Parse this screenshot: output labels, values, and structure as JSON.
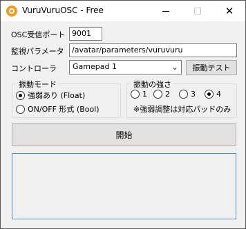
{
  "window": {
    "title": "VuruVuruOSC - Free",
    "close_glyph": "✕"
  },
  "form": {
    "osc_port_label": "OSC受信ポート",
    "osc_port_value": "9001",
    "param_label": "監視パラメータ",
    "param_value": "/avatar/parameters/vuruvuru",
    "controller_label": "コントローラ",
    "controller_selected": "Gamepad 1",
    "vibrate_test_button": "振動テスト"
  },
  "mode_group": {
    "title": "振動モード",
    "options": [
      {
        "label": "強弱あり (Float)",
        "checked": true
      },
      {
        "label": "ON/OFF 形式 (Bool)",
        "checked": false
      }
    ]
  },
  "strength_group": {
    "title": "振動の強さ",
    "options": [
      {
        "label": "1",
        "checked": false
      },
      {
        "label": "2",
        "checked": false
      },
      {
        "label": "3",
        "checked": false
      },
      {
        "label": "4",
        "checked": true
      }
    ],
    "note": "※強弱調整は対応パッドのみ"
  },
  "start_button": "開始",
  "log": ""
}
